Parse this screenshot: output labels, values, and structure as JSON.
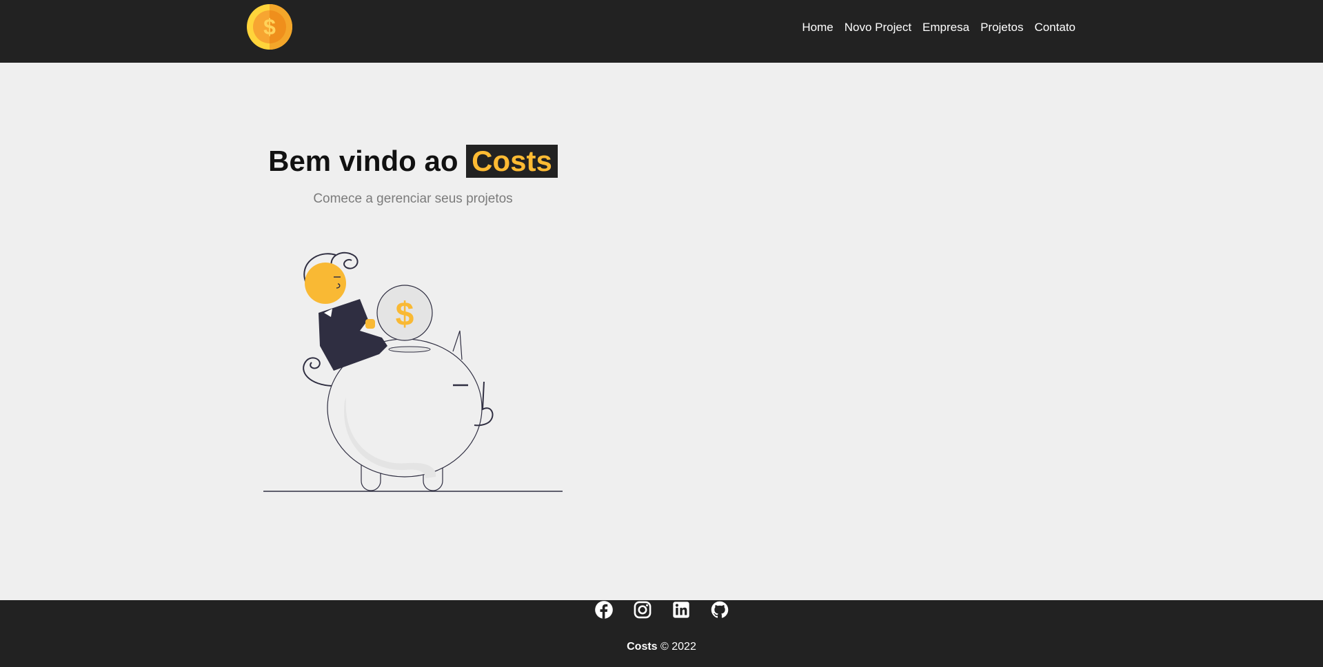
{
  "nav": {
    "links": [
      "Home",
      "Novo Project",
      "Empresa",
      "Projetos",
      "Contato"
    ]
  },
  "home": {
    "title_prefix": "Bem vindo ao ",
    "title_brand": "Costs",
    "subtitle": "Comece a gerenciar seus projetos"
  },
  "footer": {
    "social_icons": [
      "facebook-icon",
      "instagram-icon",
      "linkedin-icon",
      "github-icon"
    ],
    "brand": "Costs",
    "copyright": " © 2022"
  },
  "colors": {
    "dark": "#222222",
    "accent": "#ffbb33",
    "background": "#efefef"
  }
}
